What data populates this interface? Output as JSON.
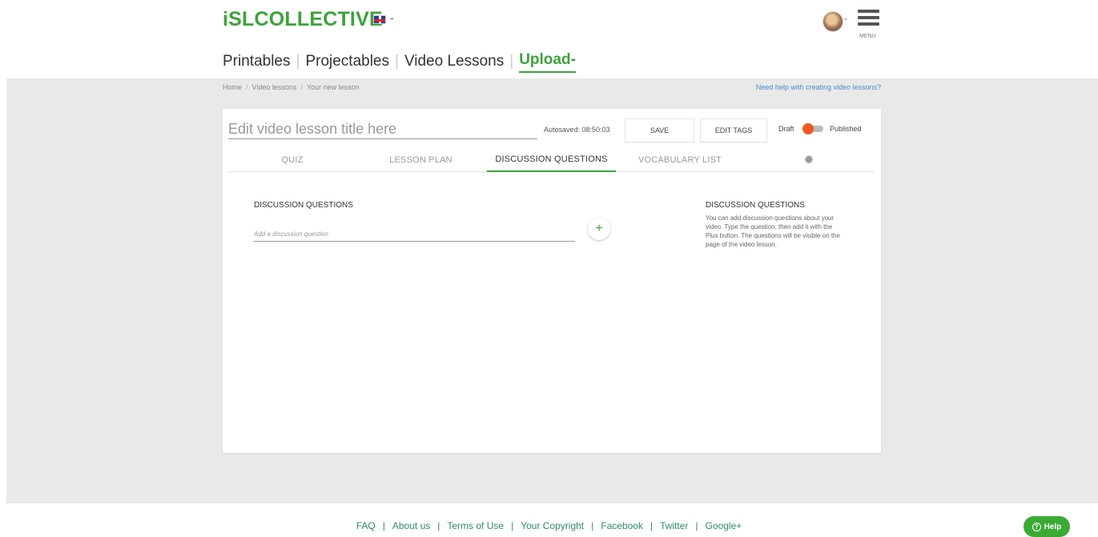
{
  "header": {
    "logo": "iSLCOLLECTIVE",
    "language_caret": "▾",
    "nav": [
      {
        "label": "Printables"
      },
      {
        "label": "Projectables"
      },
      {
        "label": "Video Lessons"
      },
      {
        "label": "Upload"
      }
    ],
    "upload_caret": "-",
    "menu_label": "MENU",
    "user_caret": "-"
  },
  "breadcrumb": [
    "Home",
    "Video lessons",
    "Your new lesson"
  ],
  "help_link": "Need help with creating video lessons?",
  "editor": {
    "title_placeholder": "Edit video lesson title here",
    "autosaved": "Autosaved: 08:50:03",
    "save_label": "SAVE",
    "edit_tags_label": "EDIT TAGS",
    "draft_label": "Draft",
    "published_label": "Published",
    "tabs": [
      {
        "label": "QUIZ"
      },
      {
        "label": "LESSON PLAN"
      },
      {
        "label": "DISCUSSION QUESTIONS",
        "active": true
      },
      {
        "label": "VOCABULARY LIST"
      }
    ],
    "settings_icon": "gear-icon"
  },
  "discussion": {
    "heading": "DISCUSSION QUESTIONS",
    "input_placeholder": "Add a discussion question",
    "add_symbol": "+",
    "side_title": "DISCUSSION QUESTIONS",
    "side_text": "You can add discussion questions about your video. Type the question, then add it with the Plus button. The questions will be visible on the page of the video lesson."
  },
  "footer": {
    "links": [
      "FAQ",
      "About us",
      "Terms of Use",
      "Your Copyright",
      "Facebook",
      "Twitter",
      "Google+"
    ],
    "separator": "|"
  },
  "help_button": {
    "label": "Help",
    "symbol": "?"
  },
  "colors": {
    "brand_green": "#3ca33a",
    "toggle_orange": "#f05a22",
    "link_blue": "#4a8ad4"
  }
}
